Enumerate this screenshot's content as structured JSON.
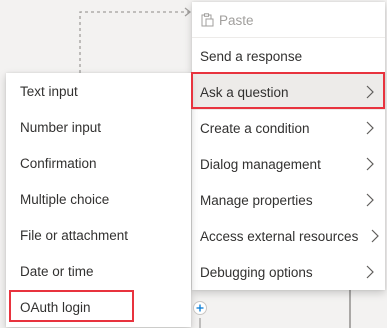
{
  "main_menu": {
    "items": [
      {
        "label": "Paste",
        "disabled": true,
        "has_submenu": false
      },
      {
        "label": "Send a response",
        "has_submenu": false
      },
      {
        "label": "Ask a question",
        "has_submenu": true,
        "highlighted": true
      },
      {
        "label": "Create a condition",
        "has_submenu": true
      },
      {
        "label": "Dialog management",
        "has_submenu": true
      },
      {
        "label": "Manage properties",
        "has_submenu": true
      },
      {
        "label": "Access external resources",
        "has_submenu": true
      },
      {
        "label": "Debugging options",
        "has_submenu": true
      }
    ]
  },
  "submenu": {
    "items": [
      {
        "label": "Text input"
      },
      {
        "label": "Number input"
      },
      {
        "label": "Confirmation"
      },
      {
        "label": "Multiple choice"
      },
      {
        "label": "File or attachment"
      },
      {
        "label": "Date or time"
      },
      {
        "label": "OAuth login",
        "highlighted": true
      }
    ]
  },
  "colors": {
    "highlight_border": "#e8333e",
    "hover_bg": "#edebe9",
    "text": "#323130",
    "disabled_text": "#a19f9d"
  },
  "icons": {
    "paste": "paste-icon",
    "chevron": "chevron-right-icon",
    "add": "plus-icon"
  }
}
